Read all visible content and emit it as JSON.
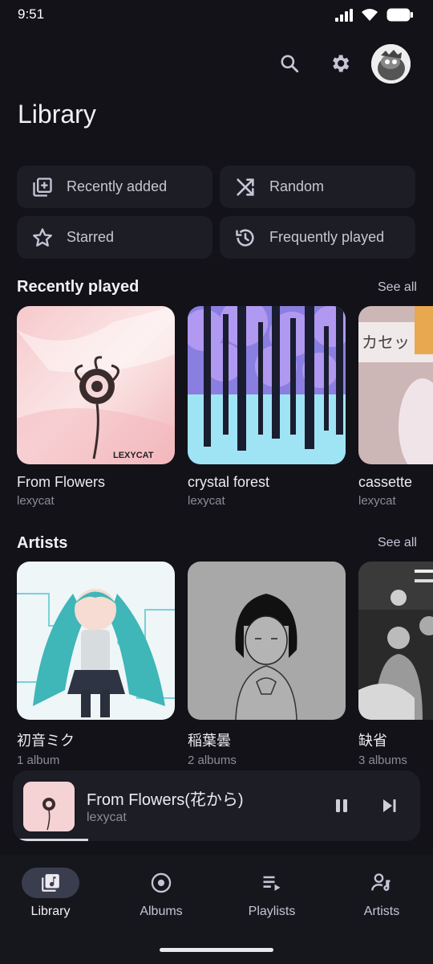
{
  "status": {
    "time": "9:51"
  },
  "header": {
    "title": "Library"
  },
  "chips": [
    {
      "label": "Recently added",
      "icon": "add-library-icon"
    },
    {
      "label": "Random",
      "icon": "shuffle-icon"
    },
    {
      "label": "Starred",
      "icon": "star-icon"
    },
    {
      "label": "Frequently played",
      "icon": "history-icon"
    }
  ],
  "recently_played": {
    "title": "Recently played",
    "see_all": "See all",
    "items": [
      {
        "name": "From Flowers",
        "artist": "lexycat",
        "art_text": "LEXYCAT"
      },
      {
        "name": "crystal forest",
        "artist": "lexycat"
      },
      {
        "name": "cassette",
        "artist": "lexycat",
        "art_text": "カセット"
      }
    ]
  },
  "artists": {
    "title": "Artists",
    "see_all": "See all",
    "items": [
      {
        "name": "初音ミク",
        "count": "1 album"
      },
      {
        "name": "稲葉曇",
        "count": "2 albums"
      },
      {
        "name": "缺省",
        "count": "3 albums"
      }
    ]
  },
  "player": {
    "title": "From Flowers(花から)",
    "artist": "lexycat",
    "progress": 0.17
  },
  "nav": [
    {
      "label": "Library",
      "icon": "library-music-icon",
      "active": true
    },
    {
      "label": "Albums",
      "icon": "album-icon",
      "active": false
    },
    {
      "label": "Playlists",
      "icon": "playlist-icon",
      "active": false
    },
    {
      "label": "Artists",
      "icon": "artist-icon",
      "active": false
    }
  ]
}
